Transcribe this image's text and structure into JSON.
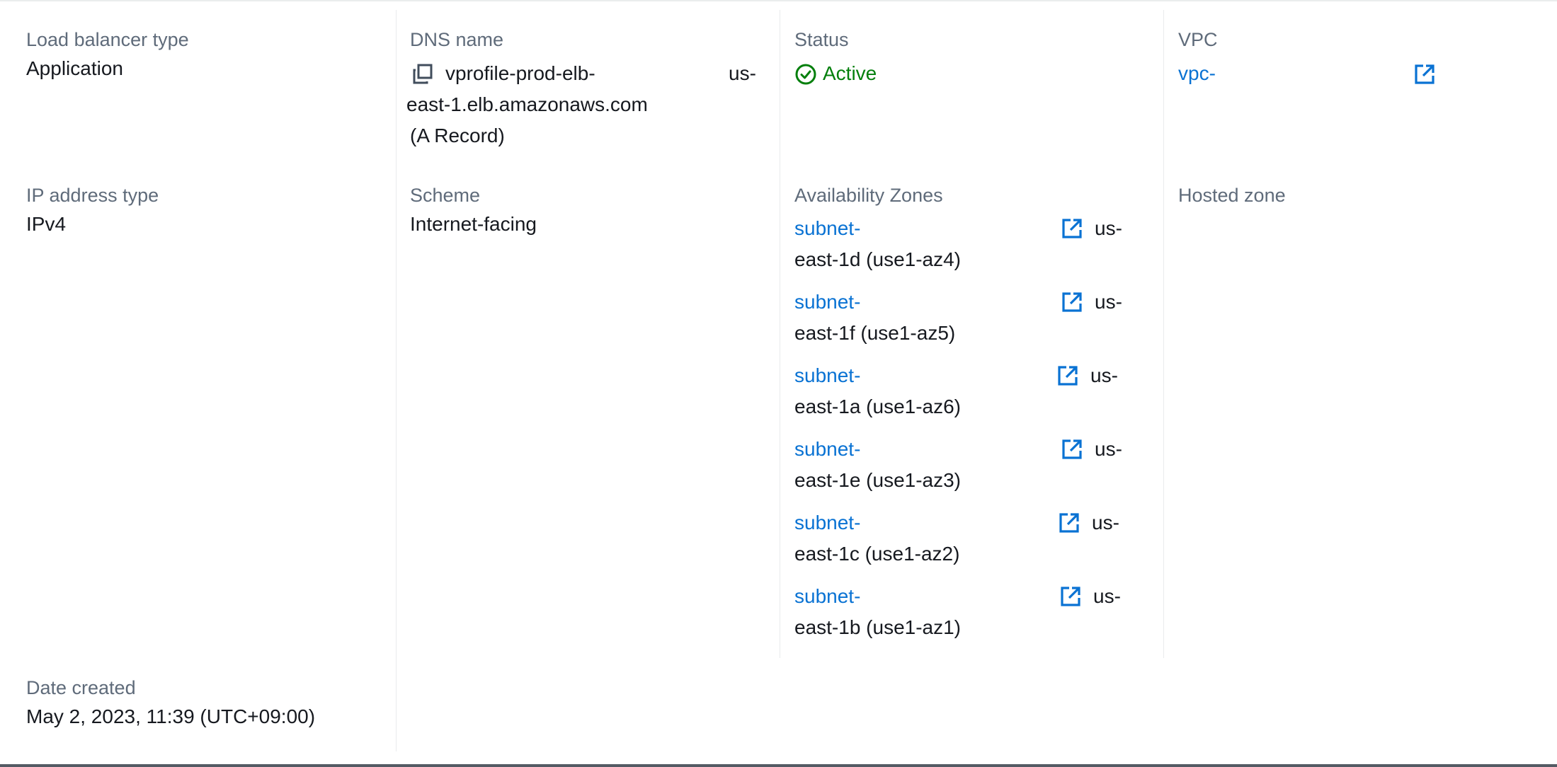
{
  "load_balancer_type": {
    "label": "Load balancer type",
    "value": "Application"
  },
  "dns_name": {
    "label": "DNS name",
    "part1": "vprofile-prod-elb-",
    "part2": "us-",
    "part3": "east-1.elb.amazonaws.com",
    "part4": "(A Record)"
  },
  "status": {
    "label": "Status",
    "value": "Active",
    "color": "#037f0c"
  },
  "vpc": {
    "label": "VPC",
    "value": "vpc-"
  },
  "ip_address_type": {
    "label": "IP address type",
    "value": "IPv4"
  },
  "scheme": {
    "label": "Scheme",
    "value": "Internet-facing"
  },
  "availability_zones": {
    "label": "Availability Zones",
    "items": [
      {
        "subnet": "subnet-",
        "region_prefix": "us-",
        "zone": "east-1d (use1-az4)"
      },
      {
        "subnet": "subnet-",
        "region_prefix": "us-",
        "zone": "east-1f (use1-az5)"
      },
      {
        "subnet": "subnet-",
        "region_prefix": "us-",
        "zone": "east-1a (use1-az6)"
      },
      {
        "subnet": "subnet-",
        "region_prefix": "us-",
        "zone": "east-1e (use1-az3)"
      },
      {
        "subnet": "subnet-",
        "region_prefix": "us-",
        "zone": "east-1c (use1-az2)"
      },
      {
        "subnet": "subnet-",
        "region_prefix": "us-",
        "zone": "east-1b (use1-az1)"
      }
    ]
  },
  "hosted_zone": {
    "label": "Hosted zone"
  },
  "date_created": {
    "label": "Date created",
    "value": "May 2, 2023, 11:39 (UTC+09:00)"
  },
  "colors": {
    "link": "#0972d3",
    "label": "#5f6b7a",
    "text": "#16191f",
    "success": "#037f0c"
  },
  "icons": {
    "copy": "copy-icon",
    "external_link": "external-link-icon",
    "status": "status-positive-icon"
  }
}
